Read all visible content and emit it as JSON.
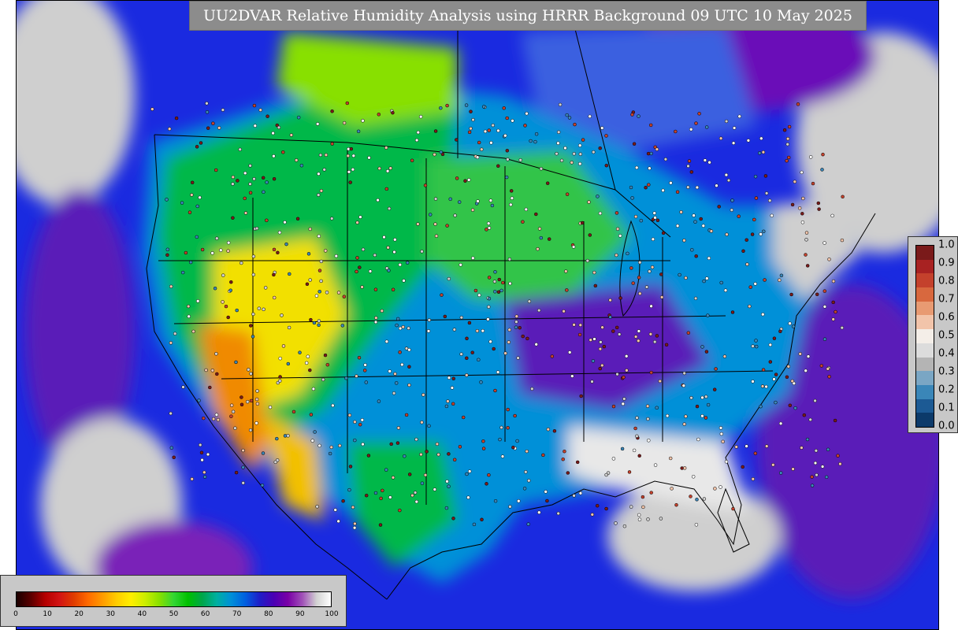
{
  "title": "UU2DVAR Relative Humidity Analysis using HRRR Background 09 UTC 10 May 2025",
  "rh_colorbar": {
    "ticks": [
      "0",
      "10",
      "20",
      "30",
      "40",
      "50",
      "60",
      "70",
      "80",
      "90",
      "100"
    ],
    "colors": [
      "#1a0000",
      "#5a0000",
      "#b40000",
      "#d21414",
      "#e03c00",
      "#ff6a00",
      "#ff9a00",
      "#ffcc00",
      "#ffee00",
      "#ccee00",
      "#88e000",
      "#33d633",
      "#00c000",
      "#00a64a",
      "#00b0a0",
      "#0090d8",
      "#0060e0",
      "#1e1ec8",
      "#4a00b4",
      "#7a00a6",
      "#a050b8",
      "#d2d2d2",
      "#ffffff"
    ]
  },
  "bias_colorbar": {
    "ticks": [
      "1.0",
      "0.9",
      "0.8",
      "0.7",
      "0.6",
      "0.5",
      "0.4",
      "0.3",
      "0.2",
      "0.1",
      "0.0"
    ],
    "colors": [
      "#7a1a1a",
      "#a82222",
      "#c4412c",
      "#d8683e",
      "#e89a72",
      "#f2c4aa",
      "#f4eee8",
      "#dcdcdc",
      "#b4b4b4",
      "#7aa6c4",
      "#3a86b8",
      "#1c5a94",
      "#0c3a6a"
    ]
  },
  "map_colors": {
    "ocean": "#1a2ae0",
    "ocean_deep": "#6a08b0",
    "cloud": "#cfcfcf",
    "land_moist": "#00b84a",
    "land_dry": "#f2e000",
    "land_verydry": "#f08a00",
    "land_blue": "#0090d8"
  }
}
